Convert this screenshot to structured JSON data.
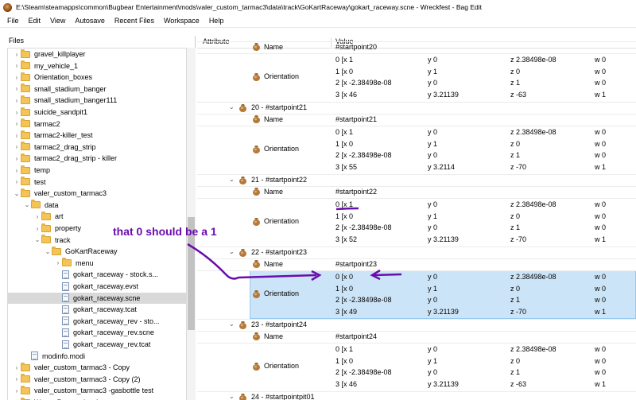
{
  "window": {
    "title": "E:\\Steam\\steamapps\\common\\Bugbear Entertainment\\mods\\valer_custom_tarmac3\\data\\track\\GoKartRaceway\\gokart_raceway.scne - Wreckfest - Bag Edit"
  },
  "menu": [
    "File",
    "Edit",
    "View",
    "Autosave",
    "Recent Files",
    "Workspace",
    "Help"
  ],
  "files": {
    "title": "Files",
    "items": [
      {
        "label": "gravel_killplayer",
        "indent": 1,
        "type": "folder",
        "chevron": ">"
      },
      {
        "label": "my_vehicle_1",
        "indent": 1,
        "type": "folder",
        "chevron": ">"
      },
      {
        "label": "Orientation_boxes",
        "indent": 1,
        "type": "folder",
        "chevron": ">"
      },
      {
        "label": "small_stadium_banger",
        "indent": 1,
        "type": "folder",
        "chevron": ">"
      },
      {
        "label": "small_stadium_banger111",
        "indent": 1,
        "type": "folder",
        "chevron": ">"
      },
      {
        "label": "suicide_sandpit1",
        "indent": 1,
        "type": "folder",
        "chevron": ">"
      },
      {
        "label": "tarmac2",
        "indent": 1,
        "type": "folder",
        "chevron": ">"
      },
      {
        "label": "tarmac2-killer_test",
        "indent": 1,
        "type": "folder",
        "chevron": ">"
      },
      {
        "label": "tarmac2_drag_strip",
        "indent": 1,
        "type": "folder",
        "chevron": ">"
      },
      {
        "label": "tarmac2_drag_strip - killer",
        "indent": 1,
        "type": "folder",
        "chevron": ">"
      },
      {
        "label": "temp",
        "indent": 1,
        "type": "folder",
        "chevron": ">"
      },
      {
        "label": "test",
        "indent": 1,
        "type": "folder",
        "chevron": ">"
      },
      {
        "label": "valer_custom_tarmac3",
        "indent": 1,
        "type": "folder",
        "chevron": "v"
      },
      {
        "label": "data",
        "indent": 2,
        "type": "folder",
        "chevron": "v"
      },
      {
        "label": "art",
        "indent": 3,
        "type": "folder",
        "chevron": ">"
      },
      {
        "label": "property",
        "indent": 3,
        "type": "folder",
        "chevron": ">"
      },
      {
        "label": "track",
        "indent": 3,
        "type": "folder",
        "chevron": "v"
      },
      {
        "label": "GoKartRaceway",
        "indent": 4,
        "type": "folder",
        "chevron": "v"
      },
      {
        "label": "menu",
        "indent": 5,
        "type": "folder",
        "chevron": ">"
      },
      {
        "label": "gokart_raceway - stock.s...",
        "indent": 5,
        "type": "file",
        "chevron": ""
      },
      {
        "label": "gokart_raceway.evst",
        "indent": 5,
        "type": "file",
        "chevron": ""
      },
      {
        "label": "gokart_raceway.scne",
        "indent": 5,
        "type": "file",
        "chevron": "",
        "selected": true
      },
      {
        "label": "gokart_raceway.tcat",
        "indent": 5,
        "type": "file",
        "chevron": ""
      },
      {
        "label": "gokart_raceway_rev - sto...",
        "indent": 5,
        "type": "file",
        "chevron": ""
      },
      {
        "label": "gokart_raceway_rev.scne",
        "indent": 5,
        "type": "file",
        "chevron": ""
      },
      {
        "label": "gokart_raceway_rev.tcat",
        "indent": 5,
        "type": "file",
        "chevron": ""
      },
      {
        "label": "modinfo.modi",
        "indent": 2,
        "type": "file",
        "chevron": ""
      },
      {
        "label": "valer_custom_tarmac3 - Copy",
        "indent": 1,
        "type": "folder",
        "chevron": ">"
      },
      {
        "label": "valer_custom_tarmac3 - Copy (2)",
        "indent": 1,
        "type": "folder",
        "chevron": ">"
      },
      {
        "label": "valer_custom_tarmac3 -gasbottle test",
        "indent": 1,
        "type": "folder",
        "chevron": ">"
      },
      {
        "label": "Water_Reservoir_v1",
        "indent": 1,
        "type": "folder",
        "chevron": ">"
      }
    ]
  },
  "grid": {
    "header": {
      "attribute": "Attribute",
      "value": "Value"
    },
    "rows": [
      {
        "kind": "attr",
        "label": "Name",
        "cols": [
          "#startpoint20"
        ]
      },
      {
        "kind": "matrix",
        "label": "Orientation",
        "rows": [
          [
            "0 [x 1",
            "y 0",
            "z 2.38498e-08",
            "w 0"
          ],
          [
            "1 [x 0",
            "y 1",
            "z 0",
            "w 0"
          ],
          [
            "2 [x -2.38498e-08",
            "y 0",
            "z 1",
            "w 0"
          ],
          [
            "3 [x 46",
            "y 3.21139",
            "z -63",
            "w 1"
          ]
        ]
      },
      {
        "kind": "group",
        "label": "20 - #startpoint21"
      },
      {
        "kind": "attr",
        "label": "Name",
        "cols": [
          "#startpoint21"
        ]
      },
      {
        "kind": "matrix",
        "label": "Orientation",
        "rows": [
          [
            "0 [x 1",
            "y 0",
            "z 2.38498e-08",
            "w 0"
          ],
          [
            "1 [x 0",
            "y 1",
            "z 0",
            "w 0"
          ],
          [
            "2 [x -2.38498e-08",
            "y 0",
            "z 1",
            "w 0"
          ],
          [
            "3 [x 55",
            "y 3.2114",
            "z -70",
            "w 1"
          ]
        ]
      },
      {
        "kind": "group",
        "label": "21 - #startpoint22"
      },
      {
        "kind": "attr",
        "label": "Name",
        "cols": [
          "#startpoint22"
        ]
      },
      {
        "kind": "matrix",
        "label": "Orientation",
        "rows": [
          [
            "0 [x 1",
            "y 0",
            "z 2.38498e-08",
            "w 0"
          ],
          [
            "1 [x 0",
            "y 1",
            "z 0",
            "w 0"
          ],
          [
            "2 [x -2.38498e-08",
            "y 0",
            "z 1",
            "w 0"
          ],
          [
            "3 [x 52",
            "y 3.21139",
            "z -70",
            "w 1"
          ]
        ]
      },
      {
        "kind": "group",
        "label": "22 - #startpoint23"
      },
      {
        "kind": "attr",
        "label": "Name",
        "cols": [
          "#startpoint23"
        ]
      },
      {
        "kind": "matrix",
        "label": "Orientation",
        "selected": true,
        "rows": [
          [
            "0 [x 0",
            "y 0",
            "z 2.38498e-08",
            "w 0"
          ],
          [
            "1 [x 0",
            "y 1",
            "z 0",
            "w 0"
          ],
          [
            "2 [x -2.38498e-08",
            "y 0",
            "z 1",
            "w 0"
          ],
          [
            "3 [x 49",
            "y 3.21139",
            "z -70",
            "w 1"
          ]
        ]
      },
      {
        "kind": "group",
        "label": "23 - #startpoint24"
      },
      {
        "kind": "attr",
        "label": "Name",
        "cols": [
          "#startpoint24"
        ]
      },
      {
        "kind": "matrix",
        "label": "Orientation",
        "rows": [
          [
            "0 [x 1",
            "y 0",
            "z 2.38498e-08",
            "w 0"
          ],
          [
            "1 [x 0",
            "y 1",
            "z 0",
            "w 0"
          ],
          [
            "2 [x -2.38498e-08",
            "y 0",
            "z 1",
            "w 0"
          ],
          [
            "3 [x 46",
            "y 3.21139",
            "z -63",
            "w 1"
          ]
        ]
      },
      {
        "kind": "group",
        "label": "24 - #startpointpit01"
      }
    ]
  },
  "annotation": {
    "text": "that 0 should be a 1",
    "color": "#6a0dad"
  }
}
